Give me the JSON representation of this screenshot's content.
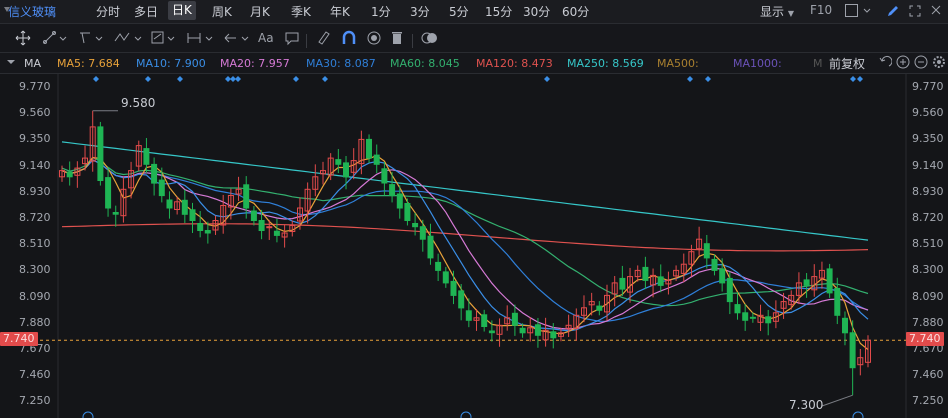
{
  "header": {
    "stock_name": "信义玻璃",
    "periods": [
      "分时",
      "多日",
      "日K",
      "周K",
      "月K",
      "季K",
      "年K",
      "1分",
      "3分",
      "5分",
      "15分",
      "30分",
      "60分"
    ],
    "active_period": "日K",
    "display_label": "显示",
    "f10_label": "F10"
  },
  "toolbar": {
    "text_tool_label": "Aa"
  },
  "ma_row": {
    "indicator_label": "MA",
    "fq_label": "前复权",
    "items": [
      {
        "label": "MA5: 7.684",
        "color": "#e8a23a"
      },
      {
        "label": "MA10: 7.900",
        "color": "#3a8ee6"
      },
      {
        "label": "MA20: 7.957",
        "color": "#d67ad6"
      },
      {
        "label": "MA30: 8.087",
        "color": "#2f7fd8"
      },
      {
        "label": "MA60: 8.045",
        "color": "#33b06f"
      },
      {
        "label": "MA120: 8.473",
        "color": "#e0524f"
      },
      {
        "label": "MA250: 8.569",
        "color": "#36c7c9"
      },
      {
        "label": "MA500:",
        "color": "#a9802f"
      },
      {
        "label": "MA1000:",
        "color": "#6a52b8"
      },
      {
        "label": "M",
        "color": "#555"
      }
    ]
  },
  "chart_data": {
    "type": "candlestick",
    "y_ticks": [
      "9.770",
      "9.560",
      "9.350",
      "9.140",
      "8.930",
      "8.720",
      "8.510",
      "8.300",
      "8.090",
      "7.880",
      "7.670",
      "7.460",
      "7.250"
    ],
    "ylim": [
      7.2,
      9.82
    ],
    "current_price": "7.740",
    "annotations": {
      "high": "9.580",
      "low": "7.300"
    },
    "colors": {
      "up": "#e34b4b",
      "down": "#1fb554",
      "ma5": "#e8a23a",
      "ma10": "#3a8ee6",
      "ma20": "#d67ad6",
      "ma30": "#2f7fd8",
      "ma60": "#33b06f",
      "ma120": "#e0524f",
      "ma250": "#36c7c9"
    },
    "closes": [
      9.1,
      9.05,
      9.12,
      9.2,
      9.45,
      9.02,
      8.8,
      8.75,
      8.95,
      9.1,
      9.3,
      9.15,
      9.0,
      8.9,
      8.8,
      8.85,
      8.75,
      8.7,
      8.62,
      8.6,
      8.7,
      8.82,
      8.9,
      8.95,
      8.8,
      8.7,
      8.62,
      8.65,
      8.58,
      8.6,
      8.66,
      8.8,
      8.95,
      9.05,
      9.1,
      9.2,
      9.15,
      9.05,
      9.18,
      9.35,
      9.2,
      9.15,
      9.0,
      8.9,
      8.8,
      8.7,
      8.65,
      8.55,
      8.4,
      8.3,
      8.2,
      8.1,
      8.0,
      7.9,
      7.92,
      7.85,
      7.8,
      7.86,
      7.92,
      7.86,
      7.8,
      7.84,
      7.78,
      7.82,
      7.76,
      7.8,
      7.86,
      7.94,
      8.0,
      8.05,
      7.98,
      8.1,
      8.2,
      8.15,
      8.25,
      8.3,
      8.22,
      8.26,
      8.18,
      8.22,
      8.3,
      8.35,
      8.45,
      8.55,
      8.4,
      8.3,
      8.2,
      8.05,
      7.96,
      7.9,
      7.92,
      7.94,
      7.88,
      7.96,
      8.05,
      8.1,
      8.2,
      8.18,
      8.25,
      8.3,
      8.12,
      7.94,
      7.8,
      7.52,
      7.6,
      7.74
    ]
  }
}
